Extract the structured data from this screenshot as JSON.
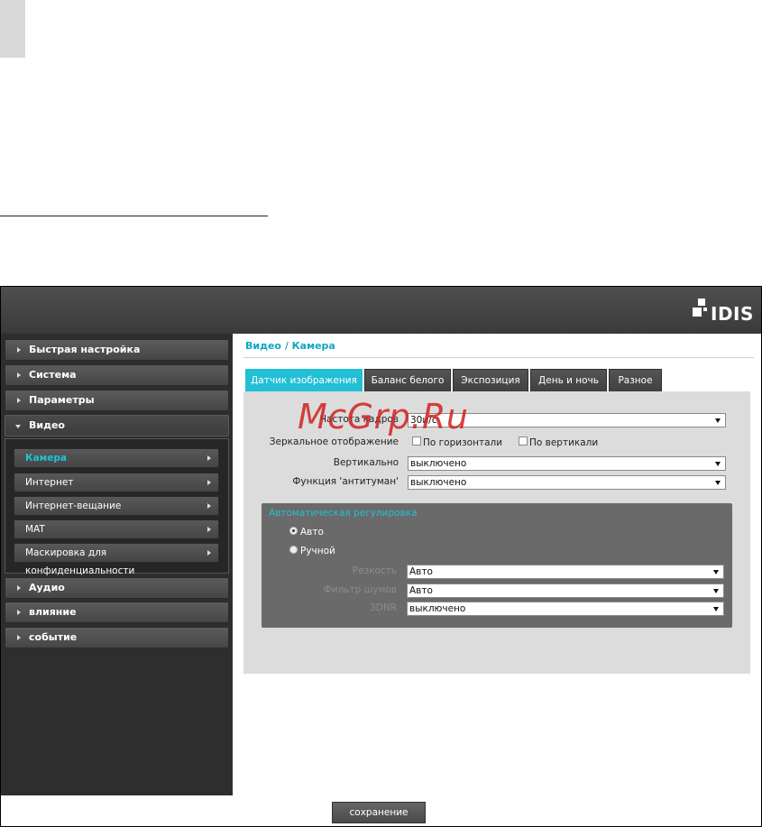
{
  "header": {
    "logo_text": "IDIS"
  },
  "sidebar": {
    "items": [
      {
        "label": "Быстрая настройка"
      },
      {
        "label": "Система"
      },
      {
        "label": "Параметры"
      },
      {
        "label": "Видео"
      },
      {
        "label": "Аудио"
      },
      {
        "label": "влияние"
      },
      {
        "label": "событие"
      }
    ],
    "video_subitems": [
      {
        "label": "Камера",
        "active": true
      },
      {
        "label": "Интернет"
      },
      {
        "label": "Интернет-вещание"
      },
      {
        "label": "MAT"
      },
      {
        "label": "Маскировка для конфиденциальности"
      }
    ]
  },
  "content": {
    "breadcrumb": "Видео / Камера",
    "tabs": [
      {
        "label": "Датчик изображения",
        "active": true
      },
      {
        "label": "Баланс белого"
      },
      {
        "label": "Экспозиция"
      },
      {
        "label": "День и ночь"
      },
      {
        "label": "Разное"
      }
    ],
    "form": {
      "frame_rate": {
        "label": "Частота кадров",
        "value": "30и/с"
      },
      "mirror": {
        "label": "Зеркальное отображение",
        "horizontal": "По горизонтали",
        "vertical": "По вертикали"
      },
      "vertical_flip": {
        "label": "Вертикально",
        "value": "выключено"
      },
      "defog": {
        "label": "Функция 'антитуман'",
        "value": "выключено"
      },
      "auto_adjust": {
        "title": "Автоматическая регулировка",
        "auto_label": "Авто",
        "manual_label": "Ручной",
        "sharpness": {
          "label": "Резкость",
          "value": "Авто"
        },
        "noise_filter": {
          "label": "Фильтр шумов",
          "value": "Авто"
        },
        "third": {
          "label": "3DNR",
          "value": "выключено"
        }
      }
    }
  },
  "footer": {
    "save_label": "сохранение"
  },
  "watermark": "McGrp.Ru",
  "colors": {
    "accent": "#23bfd5",
    "header": "#444444",
    "sidebar": "#2e2e2e",
    "panel": "#dcdcdc"
  }
}
